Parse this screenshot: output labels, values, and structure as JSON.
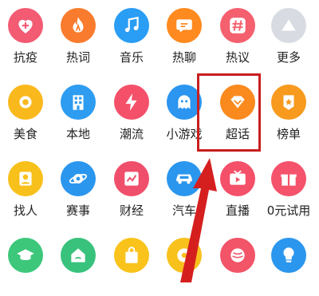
{
  "grid": {
    "rows": [
      [
        {
          "label": "抗疫",
          "icon": "heart-plus-icon",
          "color": "#f35b73"
        },
        {
          "label": "热词",
          "icon": "flame-icon",
          "color": "#f97b2d"
        },
        {
          "label": "音乐",
          "icon": "music-note-icon",
          "color": "#2a9df4"
        },
        {
          "label": "热聊",
          "icon": "chat-bubble-icon",
          "color": "#ff8a1f"
        },
        {
          "label": "热议",
          "icon": "hashtag-icon",
          "color": "#f4606e"
        },
        {
          "label": "更多",
          "icon": "triangle-icon",
          "color": "#d9dbe3"
        }
      ],
      [
        {
          "label": "美食",
          "icon": "food-icon",
          "color": "#f9b81c"
        },
        {
          "label": "本地",
          "icon": "building-icon",
          "color": "#2e9cf0"
        },
        {
          "label": "潮流",
          "icon": "lightning-icon",
          "color": "#f4506a"
        },
        {
          "label": "小游戏",
          "icon": "game-ghost-icon",
          "color": "#2b95ef"
        },
        {
          "label": "超话",
          "icon": "diamond-icon",
          "color": "#fa8a1e"
        },
        {
          "label": "榜单",
          "icon": "badge-star-icon",
          "color": "#f79a1d"
        }
      ],
      [
        {
          "label": "找人",
          "icon": "person-icon",
          "color": "#f8c01b"
        },
        {
          "label": "赛事",
          "icon": "planet-icon",
          "color": "#2b96ee"
        },
        {
          "label": "财经",
          "icon": "chart-icon",
          "color": "#ef4f6b"
        },
        {
          "label": "汽车",
          "icon": "car-icon",
          "color": "#2a96ee"
        },
        {
          "label": "直播",
          "icon": "tv-play-icon",
          "color": "#f4506a"
        },
        {
          "label": "0元试用",
          "icon": "gift-icon",
          "color": "#f5526c"
        }
      ],
      [
        {
          "label": "",
          "icon": "graduation-cap-icon",
          "color": "#3dc77b"
        },
        {
          "label": "",
          "icon": "home-wifi-icon",
          "color": "#39c27c"
        },
        {
          "label": "",
          "icon": "shopping-bag-icon",
          "color": "#f9c31b"
        },
        {
          "label": "",
          "icon": "donut-icon",
          "color": "#f9c11c"
        },
        {
          "label": "",
          "icon": "yarn-icon",
          "color": "#f25468"
        },
        {
          "label": "",
          "icon": "lightbulb-icon",
          "color": "#2b96ee"
        }
      ]
    ]
  },
  "highlight": {
    "target_label": "超话",
    "color": "#c81e1e"
  }
}
